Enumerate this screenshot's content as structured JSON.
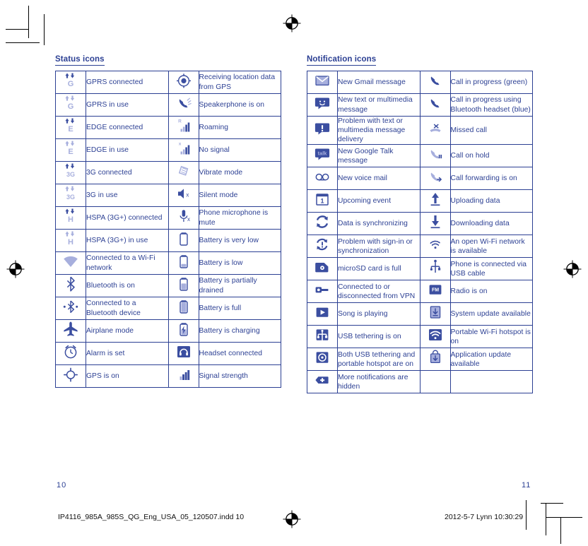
{
  "page": {
    "left_page_number": "10",
    "right_page_number": "11",
    "slug_left": "IP4116_985A_985S_QG_Eng_USA_05_120507.indd   10",
    "slug_right": "2012-5-7   Lynn 10:30:29",
    "text_color": "#2b3f93",
    "icon_fill_dark": "#3b4ea0",
    "icon_fill_light": "#a7afdd",
    "border_color": "#2b3f93"
  },
  "status_icons": {
    "title": "Status icons",
    "rows": [
      {
        "left_icon": "gprs-connected-icon",
        "left_label": "GPRS connected",
        "right_icon": "gps-location-icon",
        "right_label": "Receiving location data from GPS"
      },
      {
        "left_icon": "gprs-in-use-icon",
        "left_label": "GPRS in use",
        "right_icon": "speakerphone-icon",
        "right_label": "Speakerphone is on"
      },
      {
        "left_icon": "edge-connected-icon",
        "left_label": "EDGE connected",
        "right_icon": "roaming-icon",
        "right_label": "Roaming"
      },
      {
        "left_icon": "edge-in-use-icon",
        "left_label": "EDGE in use",
        "right_icon": "no-signal-icon",
        "right_label": "No signal"
      },
      {
        "left_icon": "3g-connected-icon",
        "left_label": "3G connected",
        "right_icon": "vibrate-mode-icon",
        "right_label": "Vibrate mode"
      },
      {
        "left_icon": "3g-in-use-icon",
        "left_label": "3G in use",
        "right_icon": "silent-mode-icon",
        "right_label": "Silent mode"
      },
      {
        "left_icon": "hspa-connected-icon",
        "left_label": "HSPA (3G+) connected",
        "right_icon": "microphone-mute-icon",
        "right_label": "Phone microphone is mute"
      },
      {
        "left_icon": "hspa-in-use-icon",
        "left_label": "HSPA (3G+) in use",
        "right_icon": "battery-very-low-icon",
        "right_label": "Battery is very low"
      },
      {
        "left_icon": "wifi-connected-icon",
        "left_label": "Connected to a Wi-Fi network",
        "right_icon": "battery-low-icon",
        "right_label": "Battery is low"
      },
      {
        "left_icon": "bluetooth-on-icon",
        "left_label": "Bluetooth is on",
        "right_icon": "battery-partial-icon",
        "right_label": "Battery is partially drained"
      },
      {
        "left_icon": "bluetooth-connected-icon",
        "left_label": "Connected to a Bluetooth device",
        "right_icon": "battery-full-icon",
        "right_label": "Battery is full"
      },
      {
        "left_icon": "airplane-mode-icon",
        "left_label": "Airplane mode",
        "right_icon": "battery-charging-icon",
        "right_label": "Battery is charging"
      },
      {
        "left_icon": "alarm-icon",
        "left_label": "Alarm is set",
        "right_icon": "headset-icon",
        "right_label": "Headset connected"
      },
      {
        "left_icon": "gps-on-icon",
        "left_label": "GPS is on",
        "right_icon": "signal-strength-icon",
        "right_label": "Signal strength"
      }
    ]
  },
  "notification_icons": {
    "title": "Notification icons",
    "rows": [
      {
        "left_icon": "gmail-icon",
        "left_label": "New Gmail message",
        "right_icon": "call-in-progress-icon",
        "right_label": "Call in progress (green)"
      },
      {
        "left_icon": "sms-message-icon",
        "left_label": "New text or multimedia message",
        "right_icon": "call-bluetooth-icon",
        "right_label": "Call in progress using Bluetooth headset (blue)"
      },
      {
        "left_icon": "message-problem-icon",
        "left_label": "Problem with text or multimedia message delivery",
        "right_icon": "missed-call-icon",
        "right_label": "Missed call"
      },
      {
        "left_icon": "google-talk-icon",
        "left_label": "New Google Talk message",
        "right_icon": "call-on-hold-icon",
        "right_label": "Call on hold"
      },
      {
        "left_icon": "voicemail-icon",
        "left_label": "New voice mail",
        "right_icon": "call-forwarding-icon",
        "right_label": "Call forwarding is on"
      },
      {
        "left_icon": "calendar-event-icon",
        "left_label": "Upcoming event",
        "right_icon": "upload-icon",
        "right_label": "Uploading data"
      },
      {
        "left_icon": "sync-icon",
        "left_label": "Data is synchronizing",
        "right_icon": "download-icon",
        "right_label": "Downloading data"
      },
      {
        "left_icon": "sync-problem-icon",
        "left_label": "Problem with sign-in or synchronization",
        "right_icon": "open-wifi-icon",
        "right_label": "An open Wi-Fi network is available"
      },
      {
        "left_icon": "sd-card-full-icon",
        "left_label": "microSD card is full",
        "right_icon": "usb-cable-icon",
        "right_label": "Phone is connected via USB cable"
      },
      {
        "left_icon": "vpn-icon",
        "left_label": "Connected to or disconnected from VPN",
        "right_icon": "fm-radio-icon",
        "right_label": "Radio is on"
      },
      {
        "left_icon": "play-song-icon",
        "left_label": "Song is playing",
        "right_icon": "system-update-icon",
        "right_label": "System update available"
      },
      {
        "left_icon": "usb-tethering-icon",
        "left_label": "USB tethering is on",
        "right_icon": "portable-hotspot-icon",
        "right_label": "Portable Wi-Fi hotspot is on"
      },
      {
        "left_icon": "tethering-hotspot-icon",
        "left_label": "Both USB tethering and portable hotspot are on",
        "right_icon": "app-update-icon",
        "right_label": "Application update available"
      },
      {
        "left_icon": "more-notifications-icon",
        "left_label": "More notifications are hidden",
        "right_icon": "",
        "right_label": ""
      }
    ]
  }
}
